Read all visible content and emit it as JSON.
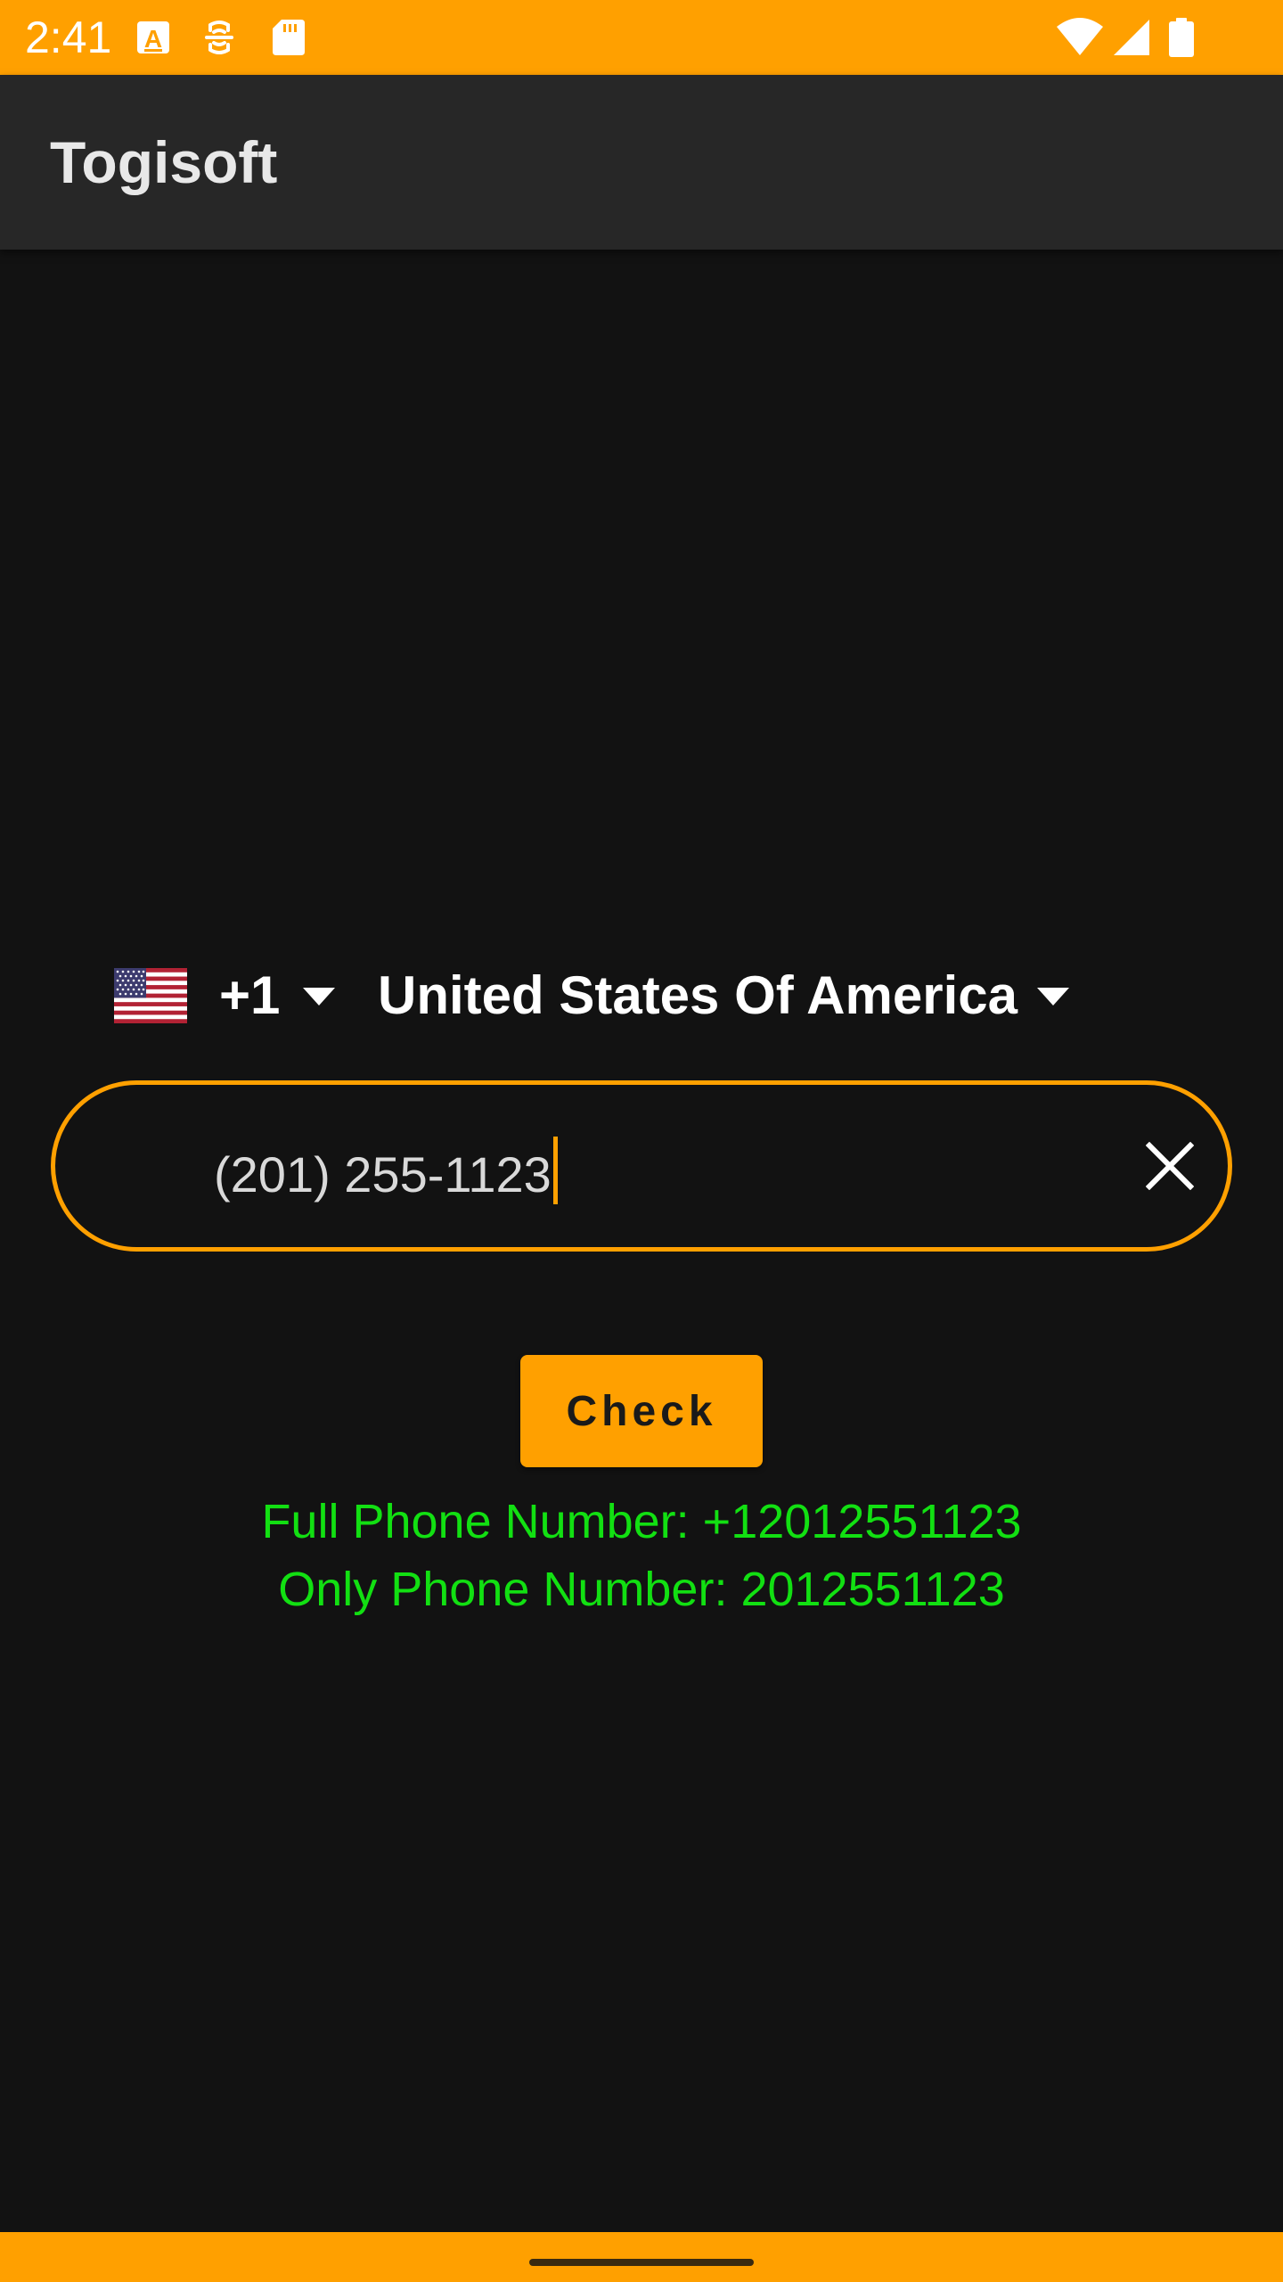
{
  "status_bar": {
    "time": "2:41",
    "background_color": "#FFA000",
    "left_icons": [
      "text-a-icon",
      "accessibility-icon",
      "sd-card-icon"
    ],
    "right_icons": [
      "wifi-icon",
      "signal-icon",
      "battery-icon"
    ]
  },
  "app_bar": {
    "title": "Togisoft",
    "background_color": "#272727"
  },
  "country_picker": {
    "flag": "us-flag-icon",
    "dial_code": "+1",
    "country_name": "United States Of America"
  },
  "phone_input": {
    "value": "(201) 255-1123",
    "border_color": "#FFA000",
    "clear_icon": "close-icon"
  },
  "check_button": {
    "label": "Check",
    "background_color": "#FFA000"
  },
  "results": {
    "full_phone": "Full Phone Number: +12012551123",
    "only_phone": "Only Phone Number: 2012551123",
    "text_color": "#12E012"
  },
  "nav_bar": {
    "background_color": "#FFA000"
  }
}
